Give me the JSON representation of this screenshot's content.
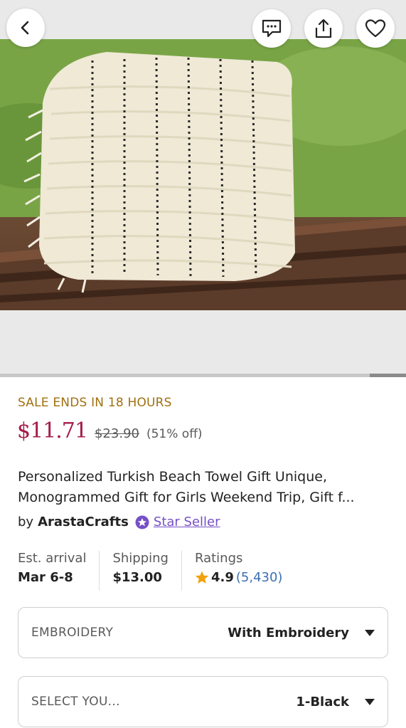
{
  "header": {
    "back_icon": "chevron-left-icon",
    "message_icon": "message-icon",
    "share_icon": "share-icon",
    "favorite_icon": "heart-icon"
  },
  "gallery": {
    "image_alt": "Stack of folded cream Turkish towels with black dotted stripes on a wooden bench",
    "progress": 0.09
  },
  "listing": {
    "sale_banner": "SALE ENDS IN 18 HOURS",
    "price": "$11.71",
    "original_price": "$23.90",
    "discount": "(51% off)",
    "title_line1": "Personalized Turkish Beach Towel Gift Unique,",
    "title_line2": "Monogrammed Gift for Girls Weekend Trip,  Gift f...",
    "by": "by",
    "shop_name": "ArastaCrafts",
    "badge_icon": "star-seller-badge-icon",
    "star_seller": "Star Seller"
  },
  "facts": {
    "arrival_label": "Est. arrival",
    "arrival_value": "Mar 6-8",
    "shipping_label": "Shipping",
    "shipping_value": "$13.00",
    "ratings_label": "Ratings",
    "rating_score": "4.9",
    "rating_count": "(5,430)"
  },
  "options": [
    {
      "label": "EMBROIDERY",
      "value": "With Embroidery"
    },
    {
      "label": "SELECT YOU...",
      "value": "1-Black"
    }
  ],
  "colors": {
    "sale": "#a0700f",
    "price": "#a61a4a",
    "star_seller": "#7650c7",
    "rating_count": "#3d6fb4",
    "star": "#f1a10d"
  }
}
